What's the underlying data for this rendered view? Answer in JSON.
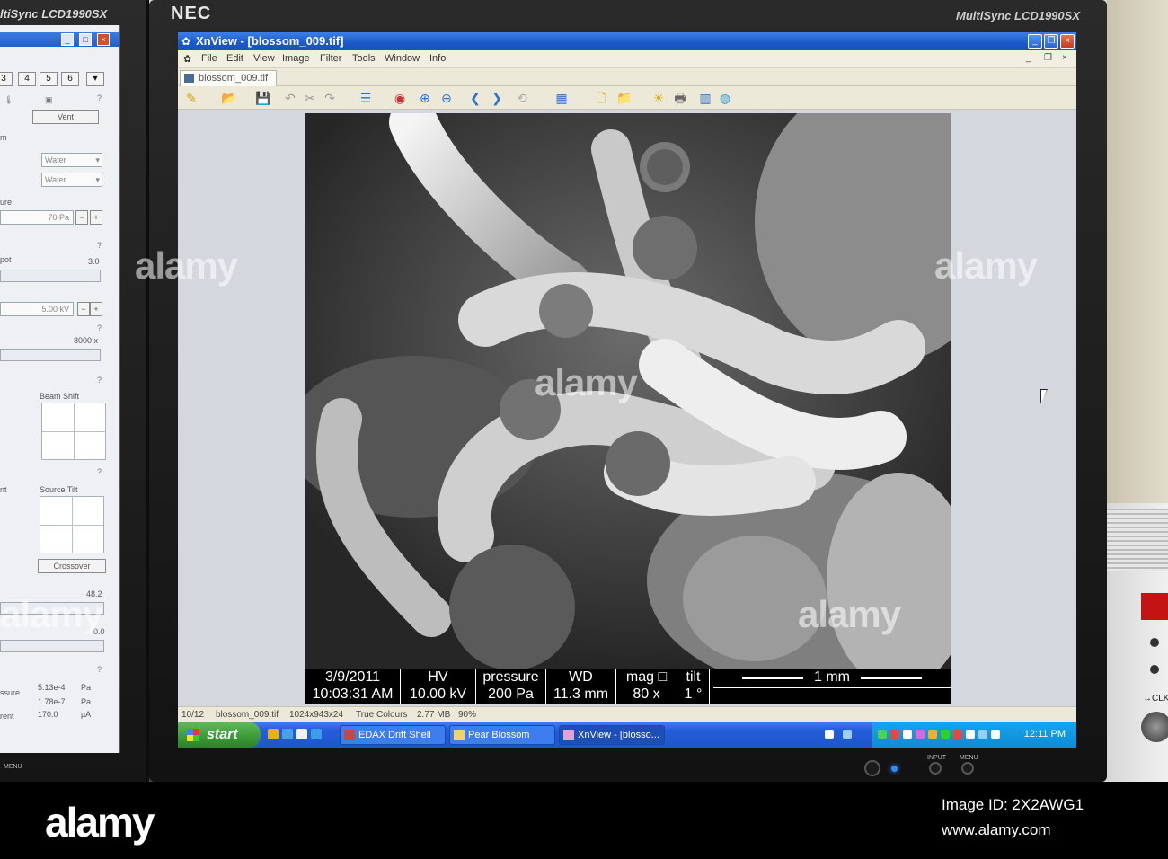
{
  "left_monitor": {
    "brand": "ltiSync LCD1990SX",
    "toolbar_tabs": [
      "3",
      "4",
      "5",
      "6"
    ],
    "vent_label": "Vent",
    "detector_row_label": "m",
    "water_1": "Water",
    "water_2": "Water",
    "pressure_label": "ure",
    "pressure_value": "70 Pa",
    "spot_label": "pot",
    "spot_value": "3.0",
    "kv_value": "5.00 kV",
    "mag_value": "8000 x",
    "beam_shift_label": "Beam Shift",
    "source_tilt_label": "Source Tilt",
    "crossover_label": "Crossover",
    "nt_label": "nt",
    "val_48": "48.2",
    "val_00": "0.0",
    "vac_label": "ssure",
    "vac_current_label": "rent",
    "vac_1": "5.13e-4",
    "vac_1_unit": "Pa",
    "vac_2": "1.78e-7",
    "vac_2_unit": "Pa",
    "vac_3": "170.0",
    "vac_3_unit": "µA",
    "menu_label": "MENU"
  },
  "monitor": {
    "brand": "NEC",
    "model": "MultiSync LCD1990SX",
    "input_label": "INPUT",
    "menu_label": "MENU"
  },
  "window": {
    "title": "XnView - [blossom_009.tif]",
    "menu": [
      "File",
      "Edit",
      "View",
      "Image",
      "Filter",
      "Tools",
      "Window",
      "Info"
    ],
    "tab_label": "blossom_009.tif"
  },
  "sem_info": {
    "date": "3/9/2011",
    "time": "10:03:31 AM",
    "hv_label": "HV",
    "hv_value": "10.00 kV",
    "pressure_label": "pressure",
    "pressure_value": "200 Pa",
    "wd_label": "WD",
    "wd_value": "11.3 mm",
    "mag_label": "mag",
    "mag_value": "80 x",
    "tilt_label": "tilt",
    "tilt_value": "1 °",
    "scale_label": "1 mm"
  },
  "statusbar": {
    "index": "10/12",
    "filename": "blossom_009.tif",
    "dimensions": "1024x943x24",
    "colours": "True Colours",
    "size": "2.77 MB",
    "zoom": "90%"
  },
  "taskbar": {
    "start_label": "start",
    "tasks": [
      "EDAX Drift Shell",
      "Pear Blossom",
      "XnView - [blosso..."
    ],
    "clock": "12:11 PM"
  },
  "watermark": "alamy",
  "strip": {
    "logo": "alamy",
    "stock_id": "Image ID: 2X2AWG1",
    "site": "www.alamy.com"
  },
  "colors": {
    "xp_blue": "#245edb",
    "xp_green": "#3a9a35",
    "tray_blue": "#0d8bd6",
    "viewer_bg": "#d4d7dd"
  }
}
